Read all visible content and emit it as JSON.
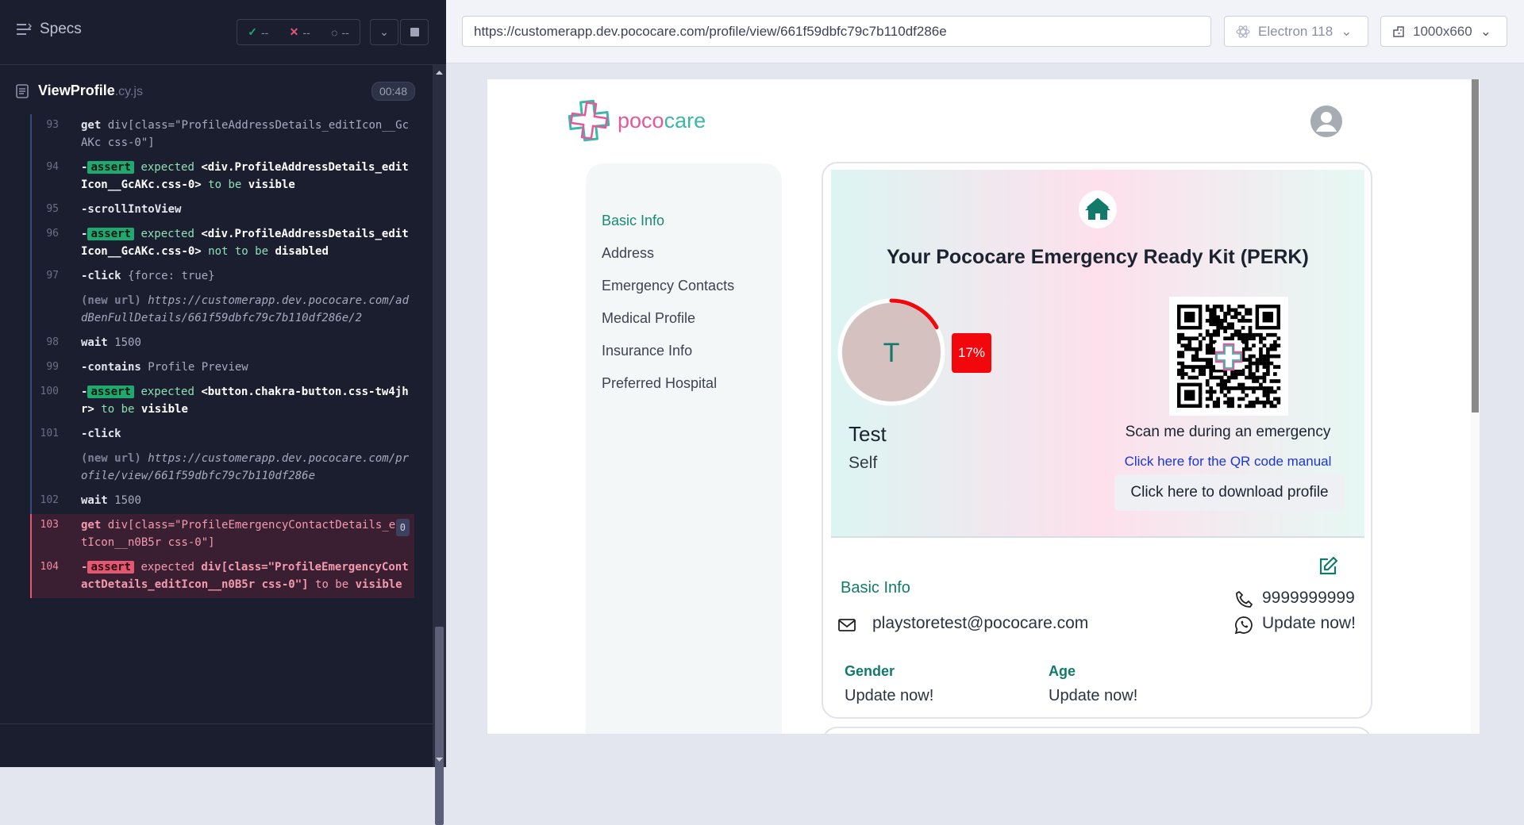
{
  "reporter": {
    "specs_label": "Specs",
    "stats": {
      "passed": "--",
      "failed": "--",
      "pending": "--"
    },
    "spec_file": {
      "name": "ViewProfile",
      "ext": ".cy.js",
      "duration": "00:48"
    },
    "commands": [
      {
        "num": "93",
        "name": "get",
        "arg": "div[class=\"ProfileAddressDetails_editIcon__GcAKc css-0\"]"
      },
      {
        "num": "94",
        "name": "-assert",
        "pre": "expected",
        "sel": "<div.ProfileAddressDetails_editIcon__GcAKc.css-0>",
        "kw": "to be",
        "post": "visible"
      },
      {
        "num": "95",
        "name": "-scrollIntoView"
      },
      {
        "num": "96",
        "name": "-assert",
        "pre": "expected",
        "sel": "<div.ProfileAddressDetails_editIcon__GcAKc.css-0>",
        "kw": "not to be",
        "post": "disabled"
      },
      {
        "num": "97",
        "name": "-click",
        "arg": "{force: true}"
      },
      {
        "num": "",
        "name": "(new url)",
        "url": "https://customerapp.dev.pococare.com/addBenFullDetails/661f59dbfc79c7b110df286e/2"
      },
      {
        "num": "98",
        "name": "wait",
        "arg": "1500"
      },
      {
        "num": "99",
        "name": "-contains",
        "arg": "Profile Preview"
      },
      {
        "num": "100",
        "name": "-assert",
        "pre": "expected",
        "sel": "<button.chakra-button.css-tw4jhr>",
        "kw": "to be",
        "post": "visible"
      },
      {
        "num": "101",
        "name": "-click"
      },
      {
        "num": "",
        "name": "(new url)",
        "url": "https://customerapp.dev.pococare.com/profile/view/661f59dbfc79c7b110df286e"
      },
      {
        "num": "102",
        "name": "wait",
        "arg": "1500"
      },
      {
        "num": "103",
        "name": "get",
        "arg": "div[class=\"ProfileEmergencyContactDetails_editIcon__n0B5r css-0\"]",
        "count": "0",
        "fail": true
      },
      {
        "num": "104",
        "name": "-assert",
        "pre": "expected",
        "sel": "div[class=\"ProfileEmergencyContactDetails_editIcon__n0B5r css-0\"]",
        "kw": "to be",
        "post": "visible",
        "fail": true
      }
    ]
  },
  "topbar": {
    "url": "https://customerapp.dev.pococare.com/profile/view/661f59dbfc79c7b110df286e",
    "browser": "Electron 118",
    "viewport": "1000x660"
  },
  "app": {
    "logo": {
      "part1": "poco",
      "part2": "care"
    },
    "nav": [
      "Basic Info",
      "Address",
      "Emergency Contacts",
      "Medical Profile",
      "Insurance Info",
      "Preferred Hospital"
    ],
    "perk": {
      "title": "Your Pococare Emergency Ready Kit (PERK)",
      "initial": "T",
      "progress_percent": 17,
      "progress_label": "17%",
      "name": "Test",
      "relation": "Self",
      "scan_text": "Scan me during an emergency",
      "qr_link": "Click here for the QR code manual",
      "download_label": "Click here to download profile"
    },
    "basic_info": {
      "title": "Basic Info",
      "phone": "9999999999",
      "email": "playstoretest@pococare.com",
      "whatsapp": "Update now!",
      "gender_label": "Gender",
      "gender_value": "Update now!",
      "age_label": "Age",
      "age_value": "Update now!"
    },
    "colors": {
      "accent": "#127a6a",
      "brand_pink": "#e4589b",
      "brand_teal": "#3bb8a8",
      "progress": "#f2070c"
    }
  }
}
